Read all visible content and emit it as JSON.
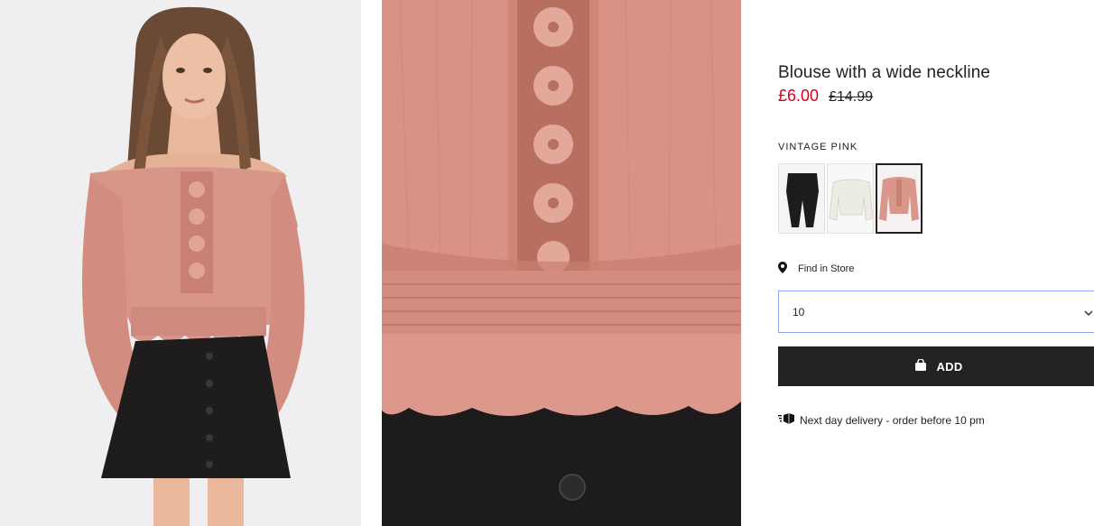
{
  "product": {
    "title": "Blouse with a wide neckline",
    "price_sale": "£6.00",
    "price_original": "£14.99",
    "color_label": "VINTAGE PINK",
    "swatches": [
      {
        "name": "black",
        "color": "#1c1c1c",
        "selected": false
      },
      {
        "name": "white",
        "color": "#f4f2ec",
        "selected": false
      },
      {
        "name": "vintage-pink",
        "color": "#d8978a",
        "selected": true
      }
    ],
    "find_in_store": "Find in Store",
    "size_selected": "10",
    "add_label": "ADD",
    "delivery_text": "Next day delivery - order before 10 pm"
  },
  "colors": {
    "sale_red": "#d6001c",
    "button_dark": "#222222",
    "focus_blue": "#8ea7f5",
    "blouse_pink": "#d99284"
  },
  "icons": [
    "location-pin-icon",
    "chevron-down-icon",
    "shopping-bag-icon",
    "delivery-truck-icon"
  ]
}
